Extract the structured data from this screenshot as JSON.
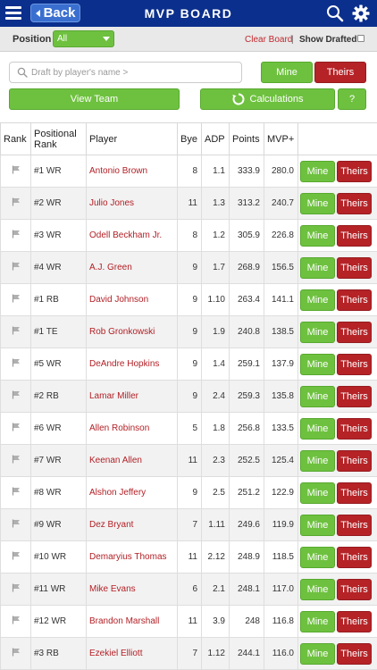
{
  "header": {
    "back_label": "Back",
    "title": "MVP BOARD"
  },
  "filters": {
    "position_label": "Position",
    "position_value": "All",
    "clear_board": "Clear Board",
    "separator": "|",
    "show_drafted": "Show Drafted"
  },
  "search": {
    "placeholder": "Draft by player's name >"
  },
  "buttons": {
    "mine": "Mine",
    "theirs": "Theirs",
    "view_team": "View Team",
    "calculations": "Calculations",
    "help": "?"
  },
  "colors": {
    "header": "#0b2f8c",
    "mine": "#6ec13f",
    "theirs": "#b52327",
    "player_text": "#b21f25"
  },
  "table": {
    "columns": [
      "Rank",
      "Positional Rank",
      "Player",
      "Bye",
      "ADP",
      "Points",
      "MVP+",
      ""
    ],
    "rows": [
      {
        "pos": "#1 WR",
        "player": "Antonio Brown",
        "bye": "8",
        "adp": "1.1",
        "points": "333.9",
        "mvp": "280.0"
      },
      {
        "pos": "#2 WR",
        "player": "Julio Jones",
        "bye": "11",
        "adp": "1.3",
        "points": "313.2",
        "mvp": "240.7"
      },
      {
        "pos": "#3 WR",
        "player": "Odell Beckham Jr.",
        "bye": "8",
        "adp": "1.2",
        "points": "305.9",
        "mvp": "226.8"
      },
      {
        "pos": "#4 WR",
        "player": "A.J. Green",
        "bye": "9",
        "adp": "1.7",
        "points": "268.9",
        "mvp": "156.5"
      },
      {
        "pos": "#1 RB",
        "player": "David Johnson",
        "bye": "9",
        "adp": "1.10",
        "points": "263.4",
        "mvp": "141.1"
      },
      {
        "pos": "#1 TE",
        "player": "Rob Gronkowski",
        "bye": "9",
        "adp": "1.9",
        "points": "240.8",
        "mvp": "138.5"
      },
      {
        "pos": "#5 WR",
        "player": "DeAndre Hopkins",
        "bye": "9",
        "adp": "1.4",
        "points": "259.1",
        "mvp": "137.9"
      },
      {
        "pos": "#2 RB",
        "player": "Lamar Miller",
        "bye": "9",
        "adp": "2.4",
        "points": "259.3",
        "mvp": "135.8"
      },
      {
        "pos": "#6 WR",
        "player": "Allen Robinson",
        "bye": "5",
        "adp": "1.8",
        "points": "256.8",
        "mvp": "133.5"
      },
      {
        "pos": "#7 WR",
        "player": "Keenan Allen",
        "bye": "11",
        "adp": "2.3",
        "points": "252.5",
        "mvp": "125.4"
      },
      {
        "pos": "#8 WR",
        "player": "Alshon Jeffery",
        "bye": "9",
        "adp": "2.5",
        "points": "251.2",
        "mvp": "122.9"
      },
      {
        "pos": "#9 WR",
        "player": "Dez Bryant",
        "bye": "7",
        "adp": "1.11",
        "points": "249.6",
        "mvp": "119.9"
      },
      {
        "pos": "#10 WR",
        "player": "Demaryius Thomas",
        "bye": "11",
        "adp": "2.12",
        "points": "248.9",
        "mvp": "118.5"
      },
      {
        "pos": "#11 WR",
        "player": "Mike Evans",
        "bye": "6",
        "adp": "2.1",
        "points": "248.1",
        "mvp": "117.0"
      },
      {
        "pos": "#12 WR",
        "player": "Brandon Marshall",
        "bye": "11",
        "adp": "3.9",
        "points": "248",
        "mvp": "116.8"
      },
      {
        "pos": "#3 RB",
        "player": "Ezekiel Elliott",
        "bye": "7",
        "adp": "1.12",
        "points": "244.1",
        "mvp": "116.0"
      }
    ]
  }
}
